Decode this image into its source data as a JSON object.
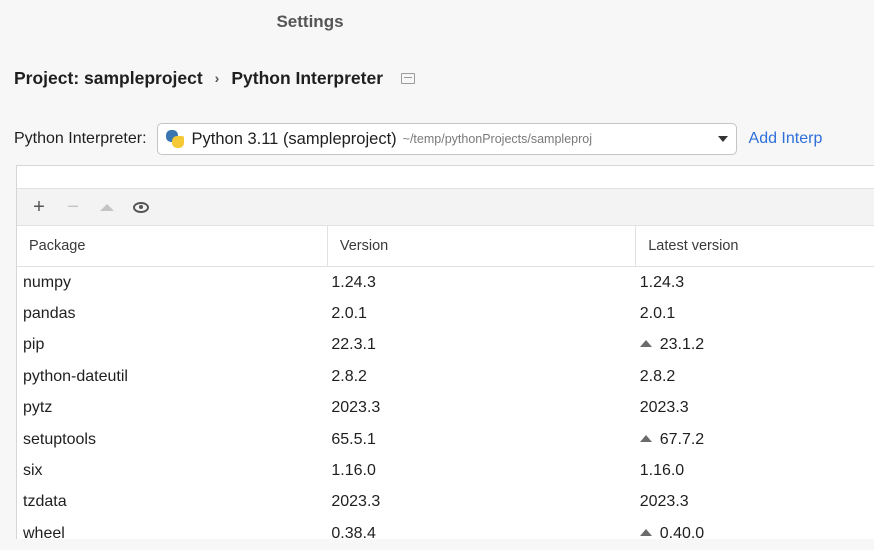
{
  "window": {
    "title": "Settings"
  },
  "breadcrumb": {
    "project": "Project: sampleproject",
    "separator": "›",
    "page": "Python Interpreter"
  },
  "interpreter": {
    "label": "Python Interpreter:",
    "name": "Python 3.11 (sampleproject)",
    "path": "~/temp/pythonProjects/sampleproj",
    "add_link": "Add Interp"
  },
  "toolbar": {
    "add": "+",
    "remove": "−"
  },
  "table": {
    "columns": [
      "Package",
      "Version",
      "Latest version"
    ],
    "rows": [
      {
        "package": "numpy",
        "version": "1.24.3",
        "latest": "1.24.3",
        "upgrade": false
      },
      {
        "package": "pandas",
        "version": "2.0.1",
        "latest": "2.0.1",
        "upgrade": false
      },
      {
        "package": "pip",
        "version": "22.3.1",
        "latest": "23.1.2",
        "upgrade": true
      },
      {
        "package": "python-dateutil",
        "version": "2.8.2",
        "latest": "2.8.2",
        "upgrade": false
      },
      {
        "package": "pytz",
        "version": "2023.3",
        "latest": "2023.3",
        "upgrade": false
      },
      {
        "package": "setuptools",
        "version": "65.5.1",
        "latest": "67.7.2",
        "upgrade": true
      },
      {
        "package": "six",
        "version": "1.16.0",
        "latest": "1.16.0",
        "upgrade": false
      },
      {
        "package": "tzdata",
        "version": "2023.3",
        "latest": "2023.3",
        "upgrade": false
      },
      {
        "package": "wheel",
        "version": "0.38.4",
        "latest": "0.40.0",
        "upgrade": true
      }
    ]
  }
}
